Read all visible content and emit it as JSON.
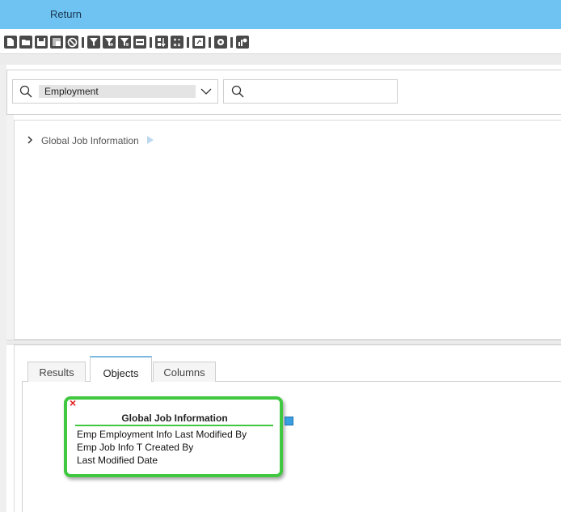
{
  "header": {
    "return_label": "Return"
  },
  "toolbar": {
    "icons": [
      "new-document-icon",
      "open-folder-icon",
      "save-icon",
      "save-as-icon",
      "cancel-icon",
      "filter-icon",
      "filter-settings-icon",
      "filter-help-icon",
      "filter-text-icon",
      "sort-az-icon",
      "calculator-icon",
      "refresh-icon",
      "gear-icon",
      "chart-icon"
    ]
  },
  "search": {
    "object_value": "Employment",
    "query_placeholder": ""
  },
  "tree": {
    "items": [
      {
        "label": "Global Job Information"
      }
    ]
  },
  "tabs": [
    {
      "label": "Results",
      "active": false
    },
    {
      "label": "Objects",
      "active": true
    },
    {
      "label": "Columns",
      "active": false
    }
  ],
  "object_card": {
    "title": "Global Job Information",
    "fields": [
      "Emp Employment Info Last Modified By",
      "Emp Job Info T Created By",
      "Last Modified Date"
    ],
    "remove_glyph": "×"
  },
  "colors": {
    "topbar": "#6ec3f2",
    "card_border": "#40c840",
    "remove": "#e02020",
    "tab_accent": "#7cb8e4"
  }
}
